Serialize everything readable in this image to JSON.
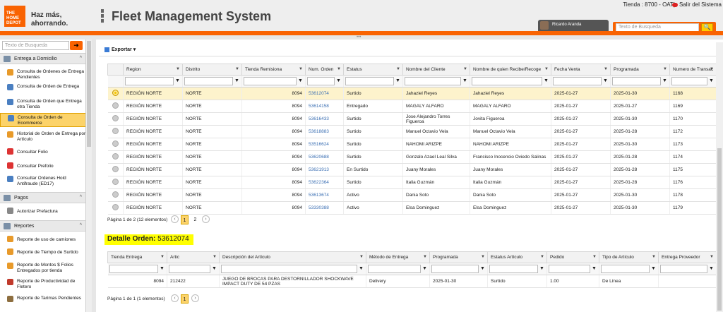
{
  "header": {
    "brand_line1": "THE HOME DEPOT",
    "tagline_line1": "Haz más,",
    "tagline_line2": "ahorrando.",
    "title": "Fleet Management System",
    "store": "Tienda : 8700 - OAT|",
    "exit_label": "Salir del Sistema",
    "user": "Ricardo Aranda",
    "search_placeholder": "Texto de Busqueda"
  },
  "sidebar": {
    "search_placeholder": "Texto de Busqueda",
    "groups": [
      {
        "label": "Entrega a Domicilio",
        "icon": "delivery-icon"
      },
      {
        "label": "Pagos",
        "icon": "payments-icon"
      },
      {
        "label": "Reportes",
        "icon": "reports-icon"
      }
    ],
    "items": [
      {
        "label": "Consulta de Ordenes de Entrega Pendientes",
        "color": "#e89a2a"
      },
      {
        "label": "Consulta de Orden de Entrega",
        "color": "#4a7fc1"
      },
      {
        "label": "Consulta de Orden que Entrega otra Tienda",
        "color": "#4a7fc1"
      },
      {
        "label": "Consulta de Orden de Ecommerce",
        "color": "#4a7fc1"
      },
      {
        "label": "Historial de Orden de Entrega por Artículo",
        "color": "#e89a2a"
      },
      {
        "label": "Consultar Folio",
        "color": "#d33"
      },
      {
        "label": "Consultar Prefolio",
        "color": "#d33"
      },
      {
        "label": "Consultar Ordenes Hold Antifraude (ED17)",
        "color": "#4a7fc1"
      },
      {
        "label": "Autorizar Prefactura",
        "color": "#888"
      },
      {
        "label": "Reporte de uso de camiones",
        "color": "#e89a2a"
      },
      {
        "label": "Reporte de Tiempo de Surtido",
        "color": "#e89a2a"
      },
      {
        "label": "Reporte de Montos $ Folios Entregados por tienda",
        "color": "#e89a2a"
      },
      {
        "label": "Reporte de Productividad de Fletero",
        "color": "#c0392b"
      },
      {
        "label": "Reporte de Tarimas Pendientes",
        "color": "#8d6e3f"
      }
    ]
  },
  "toolbar": {
    "export_label": "Exportar"
  },
  "orders_grid": {
    "columns": [
      "Region",
      "Distrito",
      "Tienda Remisiona",
      "Num. Orden",
      "Estatus",
      "Nombre del Cliente",
      "Nombre de quien Recibe/Recoge",
      "Fecha Venta",
      "Programada",
      "Numero de Transac"
    ],
    "rows": [
      [
        "REGIÓN NORTE",
        "NORTE",
        "8094",
        "53612074",
        "Surtido",
        "Jahaziel Reyes",
        "Jahaziel Reyes",
        "2025-01-27",
        "2025-01-30",
        "1168"
      ],
      [
        "REGIÓN NORTE",
        "NORTE",
        "8094",
        "53614158",
        "Entregado",
        "MAGALY ALFARO",
        "MAGALY ALFARO",
        "2025-01-27",
        "2025-01-27",
        "1169"
      ],
      [
        "REGIÓN NORTE",
        "NORTE",
        "8094",
        "53616433",
        "Surtido",
        "Jose Alejandro Torres Figueroa",
        "Jovita Figueroa",
        "2025-01-27",
        "2025-01-30",
        "1170"
      ],
      [
        "REGIÓN NORTE",
        "NORTE",
        "8094",
        "53618883",
        "Surtido",
        "Manuel Octavio Vela",
        "Manuel Octavio Vela",
        "2025-01-27",
        "2025-01-28",
        "1172"
      ],
      [
        "REGIÓN NORTE",
        "NORTE",
        "8094",
        "53516624",
        "Surtido",
        "NAHOMI ARIZPE",
        "NAHOMI ARIZPE",
        "2025-01-27",
        "2025-01-30",
        "1173"
      ],
      [
        "REGIÓN NORTE",
        "NORTE",
        "8094",
        "53620688",
        "Surtido",
        "Gonzalo Azael Leal Silva",
        "Francisco Inocencio Oviedo Salinas",
        "2025-01-27",
        "2025-01-28",
        "1174"
      ],
      [
        "REGIÓN NORTE",
        "NORTE",
        "8094",
        "53621913",
        "En Surtido",
        "Juany Morales",
        "Juany Morales",
        "2025-01-27",
        "2025-01-28",
        "1175"
      ],
      [
        "REGIÓN NORTE",
        "NORTE",
        "8094",
        "53622364",
        "Surtido",
        "Italia Guzmán",
        "Italia Guzmán",
        "2025-01-27",
        "2025-01-28",
        "1176"
      ],
      [
        "REGIÓN NORTE",
        "NORTE",
        "8094",
        "53613674",
        "Activo",
        "Dania Soto",
        "Dania Soto",
        "2025-01-27",
        "2025-01-30",
        "1178"
      ],
      [
        "REGIÓN NORTE",
        "NORTE",
        "8094",
        "53330388",
        "Activo",
        "Elsa Dominguez",
        "Elsa Dominguez",
        "2025-01-27",
        "2025-01-30",
        "1179"
      ]
    ],
    "pager_text": "Página 1 de 2 (12 elementos)",
    "pages": [
      "1",
      "2"
    ]
  },
  "detail": {
    "title_label": "Detalle Orden:",
    "order_number": "53612074",
    "columns": [
      "Tienda Entrega",
      "Artic",
      "Descripción del Artículo",
      "Método de Entrega",
      "Programada",
      "Estatus Artículo",
      "Pedido",
      "Tipo de Artículo",
      "Entrega Proveedor"
    ],
    "rows": [
      [
        "8094",
        "212422",
        "JUEGO DE BROCAS PARA DESTORNILLADOR SHOCKWAVE IMPACT DUTY DE 54 PZAS",
        "Delivery",
        "2025-01-30",
        "Surtido",
        "1.00",
        "De Línea",
        ""
      ]
    ],
    "pager_text": "Página 1 de 1 (1 elementos)",
    "pages": [
      "1"
    ]
  }
}
